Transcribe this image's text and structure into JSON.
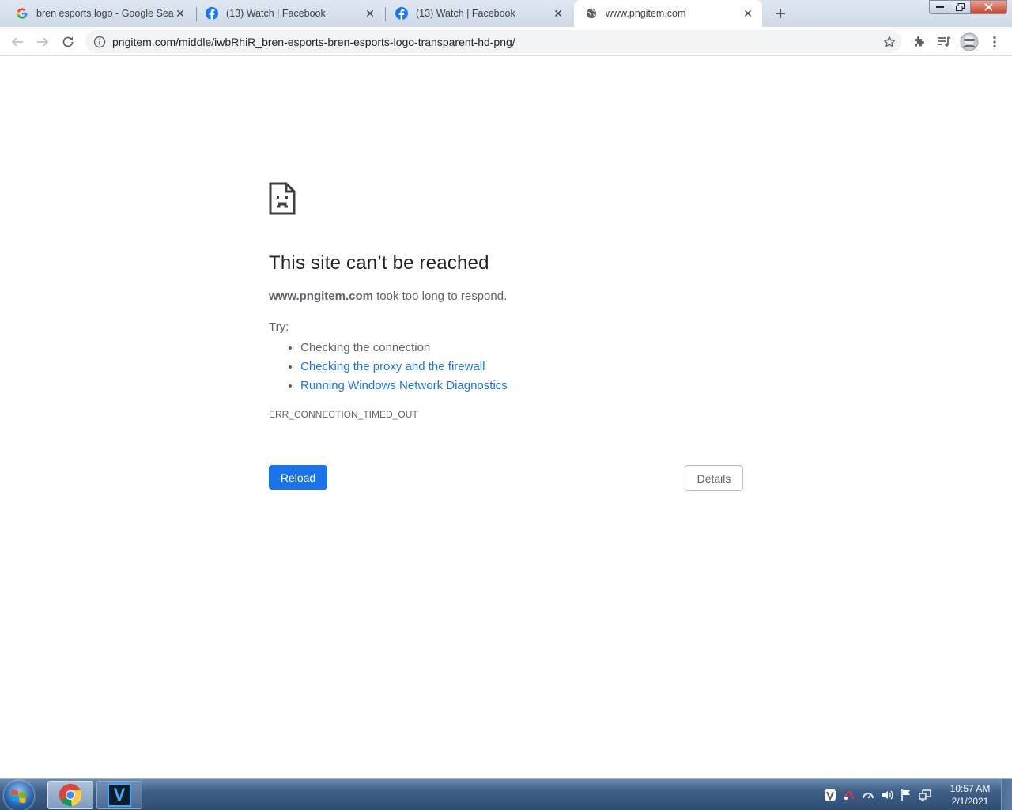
{
  "tabs": [
    {
      "title": "bren esports logo - Google Search",
      "favicon": "google-icon",
      "active": false
    },
    {
      "title": "(13) Watch | Facebook",
      "favicon": "facebook-icon",
      "active": false
    },
    {
      "title": "(13) Watch | Facebook",
      "favicon": "facebook-icon",
      "active": false
    },
    {
      "title": "www.pngitem.com",
      "favicon": "globe-icon",
      "active": true
    }
  ],
  "toolbar": {
    "url": "pngitem.com/middle/iwbRhiR_bren-esports-bren-esports-logo-transparent-hd-png/"
  },
  "error_page": {
    "heading": "This site can’t be reached",
    "host": "www.pngitem.com",
    "summary_rest": " took too long to respond.",
    "try_label": "Try:",
    "suggestions": [
      {
        "text": "Checking the connection",
        "link": false
      },
      {
        "text": "Checking the proxy and the firewall",
        "link": true
      },
      {
        "text": "Running Windows Network Diagnostics",
        "link": true
      }
    ],
    "error_code": "ERR_CONNECTION_TIMED_OUT",
    "reload_label": "Reload",
    "details_label": "Details"
  },
  "taskbar": {
    "clock_time": "10:57 AM",
    "clock_date": "2/1/2021",
    "vegas_letter": "V"
  },
  "colors": {
    "accent": "#1a73e8",
    "text_secondary": "#5f6368"
  }
}
